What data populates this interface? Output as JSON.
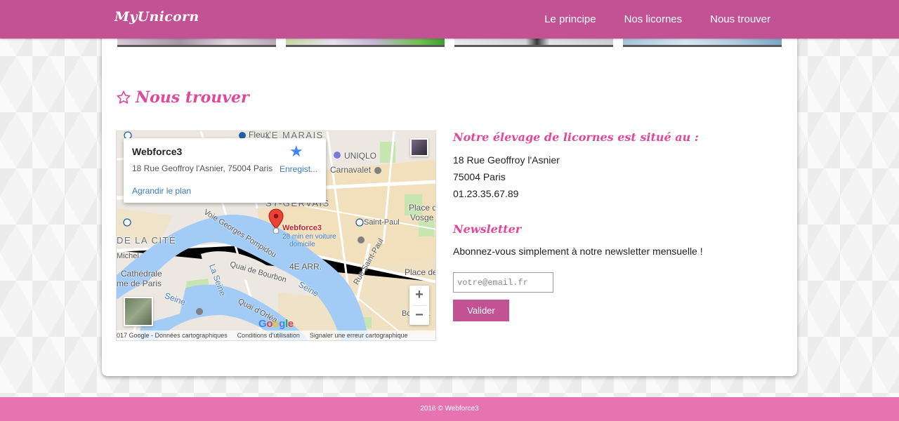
{
  "header": {
    "brand": "MyUnicorn",
    "nav": [
      "Le principe",
      "Nos licornes",
      "Nous trouver"
    ]
  },
  "section": {
    "title": "Nous trouver"
  },
  "map": {
    "info": {
      "name": "Webforce3",
      "address": "18 Rue Geoffroy l'Asnier, 75004 Paris",
      "save": "Enregist...",
      "enlarge": "Agrandir le plan"
    },
    "marker": {
      "name": "Webforce3",
      "travel_line1": "28 min en voiture",
      "travel_line2": "domicile"
    },
    "labels": {
      "le_marais": "LE MARAIS",
      "fleux": "Fleux'",
      "uniqlo": "UNIQLO",
      "carnavalet": "Carnavalet",
      "st_gervais": "ST-GERVAIS",
      "place_des_vosges": "Place d",
      "vosges": "Vosge",
      "saint_paul": "Saint-Paul",
      "ile_cite": "DE LA CITÉ",
      "michel": "Michel",
      "cathedrale": "Cathédrale",
      "notre_dame": "me de Paris",
      "quai_bourbon": "Quai de Bourbon",
      "quai_orleans": "Quai d'Orléa",
      "arr": "4E ARR.",
      "rue_saint_paul": "Rue Saint-Paul",
      "place_de": "Place de",
      "boulev": "Bouleva",
      "seine1": "Seine",
      "seine2": "Seine",
      "la_seine": "La Seine",
      "georges_pompidou": "Voie Georges Pompidou"
    },
    "google": "Google",
    "footer": {
      "copyright": "017 Google - Données cartographiques",
      "terms": "Conditions d'utilisation",
      "report": "Signaler une erreur cartographique"
    },
    "colors": {
      "water": "#a2cbf5",
      "park": "#c6e5b0",
      "road": "#ffffff",
      "block": "#ece8e1",
      "tan": "#f2dfbb"
    }
  },
  "address": {
    "title": "Notre élevage de licornes est situé au :",
    "street": "18 Rue Geoffroy l'Asnier",
    "city": "75004 Paris",
    "phone": "01.23.35.67.89"
  },
  "newsletter": {
    "title": "Newsletter",
    "text": "Abonnez-vous simplement à notre newsletter mensuelle !",
    "placeholder": "votre@email.fr",
    "button": "Valider"
  },
  "footer": {
    "text": "2016 © Webforce3"
  },
  "colors": {
    "primary": "#c25294",
    "accent": "#e0489a",
    "footer": "#e574b0"
  }
}
